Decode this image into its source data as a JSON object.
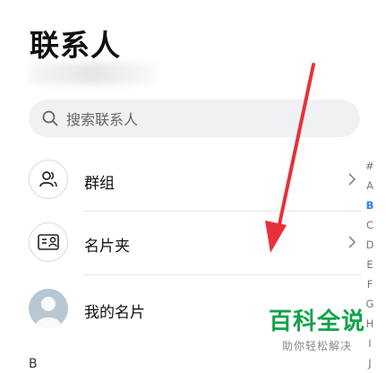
{
  "header": {
    "title": "联系人"
  },
  "search": {
    "placeholder": "搜索联系人",
    "icon": "search-icon"
  },
  "rows": [
    {
      "label": "群组",
      "icon": "group-icon"
    },
    {
      "label": "名片夹",
      "icon": "business-card-icon"
    },
    {
      "label": "我的名片",
      "icon": "avatar"
    }
  ],
  "index_letters": [
    "#",
    "A",
    "B",
    "C",
    "D",
    "E",
    "F",
    "G",
    "H",
    "I",
    "J"
  ],
  "active_letter": "B",
  "section_header": "B",
  "watermark": {
    "title": "百科全说",
    "subtitle": "助你轻松解决"
  },
  "colors": {
    "accent": "#2b7cff",
    "annotation_arrow": "#e8303b",
    "watermark": "#13a34a"
  }
}
